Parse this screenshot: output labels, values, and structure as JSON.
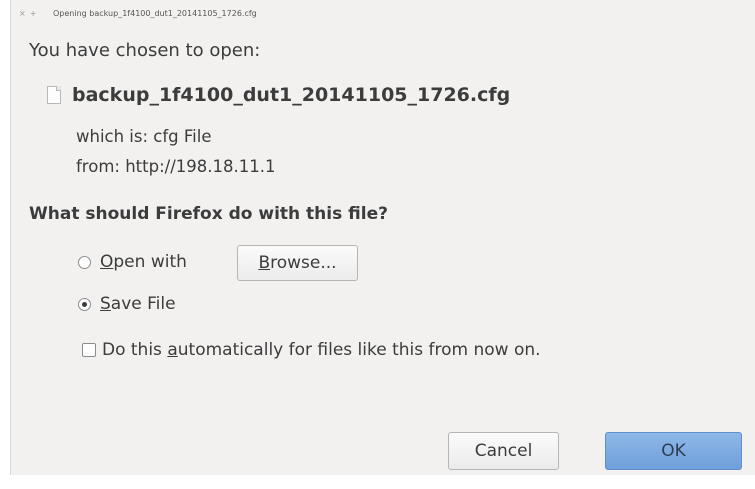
{
  "window": {
    "title": "Opening backup_1f4100_dut1_20141105_1726.cfg",
    "close_glyph": "×",
    "minimize_glyph": "+"
  },
  "dialog": {
    "heading": "You have chosen to open:",
    "file_icon": "document-icon",
    "filename": "backup_1f4100_dut1_20141105_1726.cfg",
    "which_is": "which is:  cfg File",
    "from": "from:  http://198.18.11.1",
    "question": "What should Firefox do with this file?",
    "options": {
      "open_with": {
        "accel": "O",
        "rest": "pen with",
        "selected": false
      },
      "save_file": {
        "accel": "S",
        "rest": "ave File",
        "selected": true
      }
    },
    "browse": {
      "accel": "B",
      "rest": "rowse..."
    },
    "auto_checkbox": {
      "before": "Do this ",
      "accel": "a",
      "after": "utomatically for files like this from now on.",
      "checked": false
    },
    "buttons": {
      "cancel": "Cancel",
      "ok": "OK"
    }
  },
  "colors": {
    "dialog_bg": "#f2f1f0",
    "ok_button": "#7aa8e0",
    "text": "#3c3c3c"
  }
}
